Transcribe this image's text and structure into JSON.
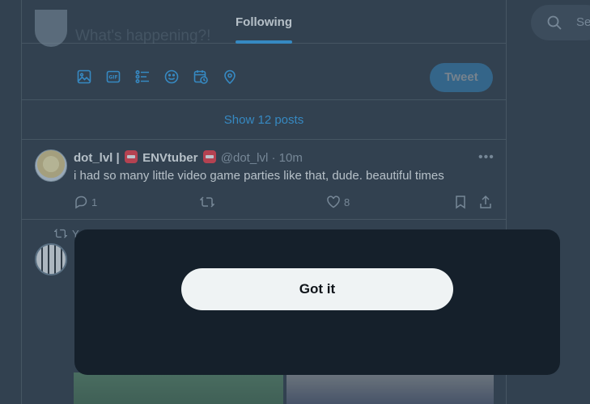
{
  "header": {
    "tab_following": "Following",
    "compose_placeholder": "What's happening?!"
  },
  "compose_tools": {
    "icons": [
      "image-icon",
      "gif-icon",
      "poll-icon",
      "emoji-icon",
      "schedule-icon",
      "location-icon"
    ],
    "tweet_label": "Tweet"
  },
  "timeline": {
    "show_posts": "Show 12 posts",
    "post1": {
      "name_part1": "dot_lvl |",
      "name_part2": "ENVtuber",
      "handle_time": "@dot_lvl · 10m",
      "text": "i had so many little video game parties like that, dude. beautiful times",
      "replies": "1",
      "likes": "8"
    },
    "post2": {
      "retweet_by": "Y"
    }
  },
  "search": {
    "placeholder": "Se"
  },
  "modal": {
    "got_it_label": "Got it"
  },
  "colors": {
    "accent": "#1d9bf0",
    "background": "#15202b",
    "border": "#38444d",
    "secondary_text": "#8b98a5"
  }
}
